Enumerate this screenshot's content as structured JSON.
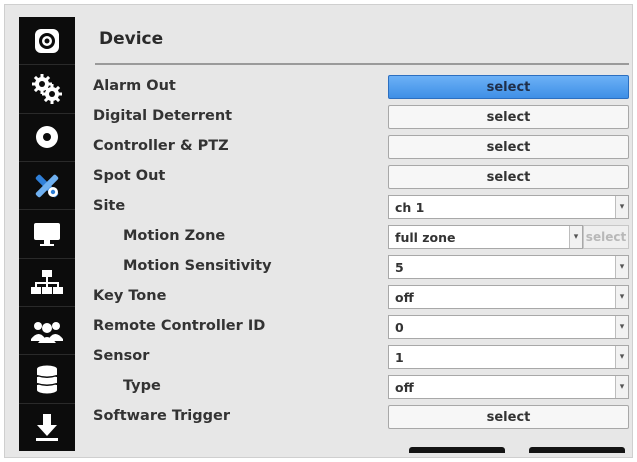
{
  "page": {
    "title": "Device"
  },
  "sidebar": {
    "items": [
      {
        "icon": "camera-lens-icon"
      },
      {
        "icon": "gears-icon"
      },
      {
        "icon": "disc-icon"
      },
      {
        "icon": "tools-icon"
      },
      {
        "icon": "monitor-icon"
      },
      {
        "icon": "network-icon"
      },
      {
        "icon": "users-icon"
      },
      {
        "icon": "database-icon"
      },
      {
        "icon": "download-icon"
      }
    ]
  },
  "rows": {
    "alarm_out": {
      "label": "Alarm Out",
      "button": "select"
    },
    "digital_deterrent": {
      "label": "Digital Deterrent",
      "button": "select"
    },
    "controller_ptz": {
      "label": "Controller & PTZ",
      "button": "select"
    },
    "spot_out": {
      "label": "Spot Out",
      "button": "select"
    },
    "site": {
      "label": "Site",
      "value": "ch 1"
    },
    "motion_zone": {
      "label": "Motion Zone",
      "value": "full zone",
      "button": "select"
    },
    "motion_sensitivity": {
      "label": "Motion Sensitivity",
      "value": "5"
    },
    "key_tone": {
      "label": "Key Tone",
      "value": "off"
    },
    "remote_controller_id": {
      "label": "Remote Controller ID",
      "value": "0"
    },
    "sensor": {
      "label": "Sensor",
      "value": "1"
    },
    "type": {
      "label": "Type",
      "value": "off"
    },
    "software_trigger": {
      "label": "Software Trigger",
      "button": "select"
    }
  },
  "colors": {
    "accent": "#4a97ea",
    "sidebar": "#0c0c0c",
    "panel": "#e7e7e7"
  }
}
